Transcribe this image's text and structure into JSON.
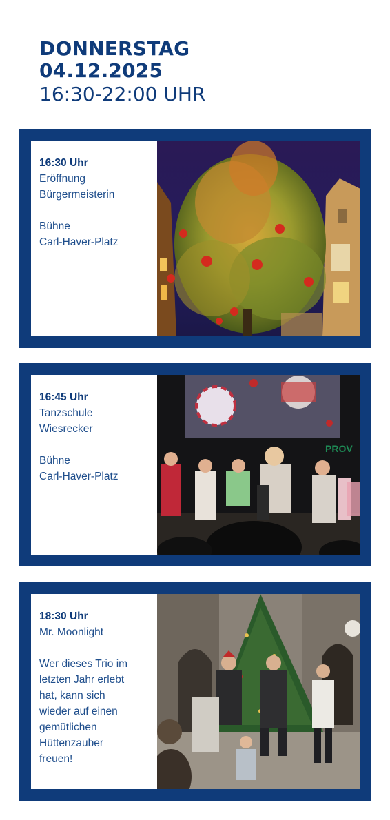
{
  "header": {
    "day": "DONNERSTAG",
    "date": "04.12.2025",
    "time": "16:30-22:00 UHR"
  },
  "colors": {
    "brand_blue": "#0f3b7a",
    "text_blue": "#1f4e8c"
  },
  "events": [
    {
      "time": "16:30 Uhr",
      "title_lines": [
        "Eröffnung",
        "Bürgermeisterin"
      ],
      "location_lines": [
        "Bühne",
        "Carl-Haver-Platz"
      ],
      "photo": "christmas-tree-night-photo"
    },
    {
      "time": "16:45 Uhr",
      "title_lines": [
        "Tanzschule",
        "Wiesrecker"
      ],
      "location_lines": [
        "Bühne",
        "Carl-Haver-Platz"
      ],
      "photo_text": "PROV",
      "photo": "dance-performance-stage-photo"
    },
    {
      "time": "18:30 Uhr",
      "title_lines": [
        "Mr. Moonlight"
      ],
      "description_lines": [
        "Wer dieses Trio im",
        "letzten Jahr erlebt",
        "hat, kann sich",
        "wieder auf einen",
        "gemütlichen",
        "Hüttenzauber",
        "freuen!"
      ],
      "photo": "trio-band-market-photo"
    }
  ]
}
